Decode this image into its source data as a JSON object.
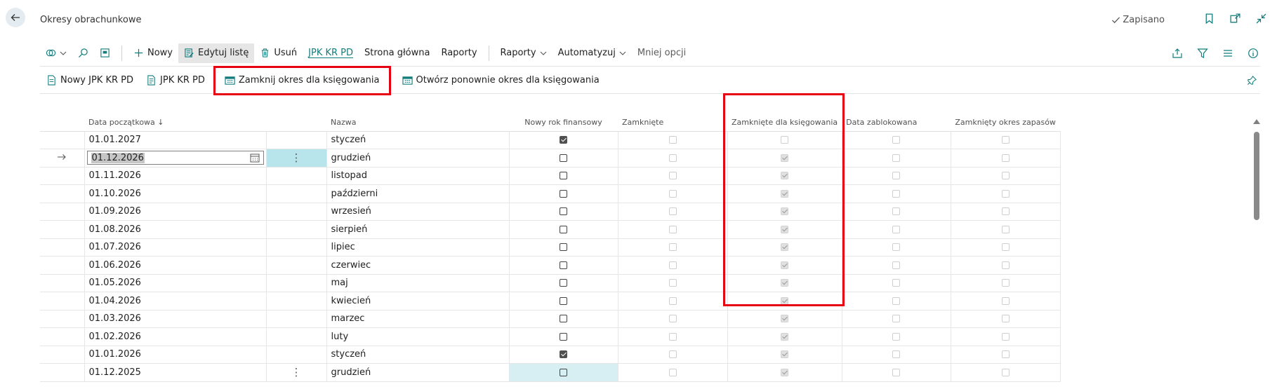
{
  "page": {
    "title": "Okresy obrachunkowe",
    "status": "Zapisano"
  },
  "actionbar": {
    "new": "Nowy",
    "edit_list": "Edytuj listę",
    "delete": "Usuń",
    "jpk": "JPK KR PD",
    "home": "Strona główna",
    "reports1": "Raporty",
    "reports2": "Raporty",
    "automate": "Automatyzuj",
    "less": "Mniej opcji"
  },
  "subbar": {
    "new_jpk": "Nowy JPK KR PD",
    "jpk": "JPK KR PD",
    "close_period": "Zamknij okres dla księgowania",
    "reopen_period": "Otwórz ponownie okres dla księgowania"
  },
  "grid": {
    "columns": {
      "start_date": "Data początkowa",
      "start_date_sort": "↓",
      "name": "Nazwa",
      "new_fiscal_year": "Nowy rok finansowy",
      "closed": "Zamknięte",
      "closed_for_posting": "Zamknięte dla księgowania",
      "date_locked": "Data zablokowana",
      "inventory_closed": "Zamknięty okres zapasów"
    },
    "rows": [
      {
        "date": "01.01.2027",
        "name": "styczeń",
        "new_fy": true,
        "closed": false,
        "closed_posting": false,
        "locked": false,
        "inv_closed": false
      },
      {
        "date": "01.12.2026",
        "name": "grudzień",
        "new_fy": false,
        "closed": false,
        "closed_posting": true,
        "locked": false,
        "inv_closed": false
      },
      {
        "date": "01.11.2026",
        "name": "listopad",
        "new_fy": false,
        "closed": false,
        "closed_posting": true,
        "locked": false,
        "inv_closed": false
      },
      {
        "date": "01.10.2026",
        "name": "październi",
        "new_fy": false,
        "closed": false,
        "closed_posting": true,
        "locked": false,
        "inv_closed": false
      },
      {
        "date": "01.09.2026",
        "name": "wrzesień",
        "new_fy": false,
        "closed": false,
        "closed_posting": true,
        "locked": false,
        "inv_closed": false
      },
      {
        "date": "01.08.2026",
        "name": "sierpień",
        "new_fy": false,
        "closed": false,
        "closed_posting": true,
        "locked": false,
        "inv_closed": false
      },
      {
        "date": "01.07.2026",
        "name": "lipiec",
        "new_fy": false,
        "closed": false,
        "closed_posting": true,
        "locked": false,
        "inv_closed": false
      },
      {
        "date": "01.06.2026",
        "name": "czerwiec",
        "new_fy": false,
        "closed": false,
        "closed_posting": true,
        "locked": false,
        "inv_closed": false
      },
      {
        "date": "01.05.2026",
        "name": "maj",
        "new_fy": false,
        "closed": false,
        "closed_posting": true,
        "locked": false,
        "inv_closed": false
      },
      {
        "date": "01.04.2026",
        "name": "kwiecień",
        "new_fy": false,
        "closed": false,
        "closed_posting": true,
        "locked": false,
        "inv_closed": false
      },
      {
        "date": "01.03.2026",
        "name": "marzec",
        "new_fy": false,
        "closed": false,
        "closed_posting": true,
        "locked": false,
        "inv_closed": false
      },
      {
        "date": "01.02.2026",
        "name": "luty",
        "new_fy": false,
        "closed": false,
        "closed_posting": true,
        "locked": false,
        "inv_closed": false
      },
      {
        "date": "01.01.2026",
        "name": "styczeń",
        "new_fy": true,
        "closed": false,
        "closed_posting": true,
        "locked": false,
        "inv_closed": false
      },
      {
        "date": "01.12.2025",
        "name": "grudzień",
        "new_fy": false,
        "closed": false,
        "closed_posting": true,
        "locked": false,
        "inv_closed": false
      }
    ],
    "selected_row": 1
  },
  "colors": {
    "accent": "#107c7c",
    "highlight": "#e60012",
    "selected_cell": "#b8e5eb"
  },
  "icons": {
    "back": "back-arrow-icon",
    "saved": "checkmark-icon",
    "bookmark": "bookmark-icon",
    "open_new": "open-new-window-icon",
    "collapse": "collapse-icon",
    "share": "share-icon",
    "filter": "filter-icon",
    "list": "list-icon",
    "info": "info-icon",
    "pin": "pin-icon"
  }
}
